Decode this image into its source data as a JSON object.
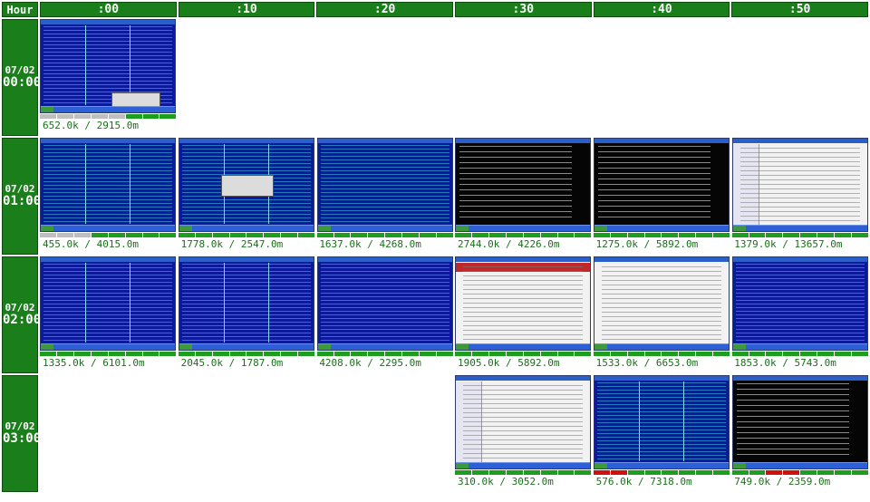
{
  "header": {
    "hour_label": "Hour",
    "columns": [
      ":00",
      ":10",
      ":20",
      ":30",
      ":40",
      ":50"
    ]
  },
  "rows": [
    {
      "date": "07/02",
      "time": "00:00",
      "cells": [
        {
          "theme": "blue",
          "stats": "652.0k / 2915.0m",
          "dialog": "small",
          "bars": "ggggg---"
        },
        null,
        null,
        null,
        null,
        null
      ]
    },
    {
      "date": "07/02",
      "time": "01:00",
      "cells": [
        {
          "theme": "blue",
          "stats": "455.0k / 4015.0m",
          "bars": "ggg-----"
        },
        {
          "theme": "blue",
          "stats": "1778.0k / 2547.0m",
          "dialog": "center",
          "bars": "--------"
        },
        {
          "theme": "blue-term",
          "stats": "1637.0k / 4268.0m",
          "bars": "--------"
        },
        {
          "theme": "black",
          "stats": "2744.0k / 4226.0m",
          "bars": "--------"
        },
        {
          "theme": "black",
          "stats": "1275.0k / 5892.0m",
          "bars": "--------"
        },
        {
          "theme": "web",
          "stats": "1379.0k / 13657.0m",
          "bars": "--------"
        }
      ]
    },
    {
      "date": "07/02",
      "time": "02:00",
      "cells": [
        {
          "theme": "blue",
          "stats": "1335.0k / 6101.0m",
          "bars": "--------"
        },
        {
          "theme": "blue",
          "stats": "2045.0k / 1787.0m",
          "bars": "--------"
        },
        {
          "theme": "blue-term",
          "stats": "4208.0k / 2295.0m",
          "bars": "--------"
        },
        {
          "theme": "web-red",
          "stats": "1905.0k / 5892.0m",
          "bars": "--------"
        },
        {
          "theme": "white",
          "stats": "1533.0k / 6653.0m",
          "bars": "--------"
        },
        {
          "theme": "blue-term",
          "stats": "1853.0k / 5743.0m",
          "bars": "--------"
        }
      ]
    },
    {
      "date": "07/02",
      "time": "03:00",
      "cells": [
        null,
        null,
        null,
        {
          "theme": "web-side",
          "stats": "310.0k / 3052.0m",
          "bars": "--------"
        },
        {
          "theme": "blue",
          "stats": "576.0k / 7318.0m",
          "bars": "rr------"
        },
        {
          "theme": "black",
          "stats": "749.0k / 2359.0m",
          "bars": "--rr----"
        }
      ]
    }
  ]
}
